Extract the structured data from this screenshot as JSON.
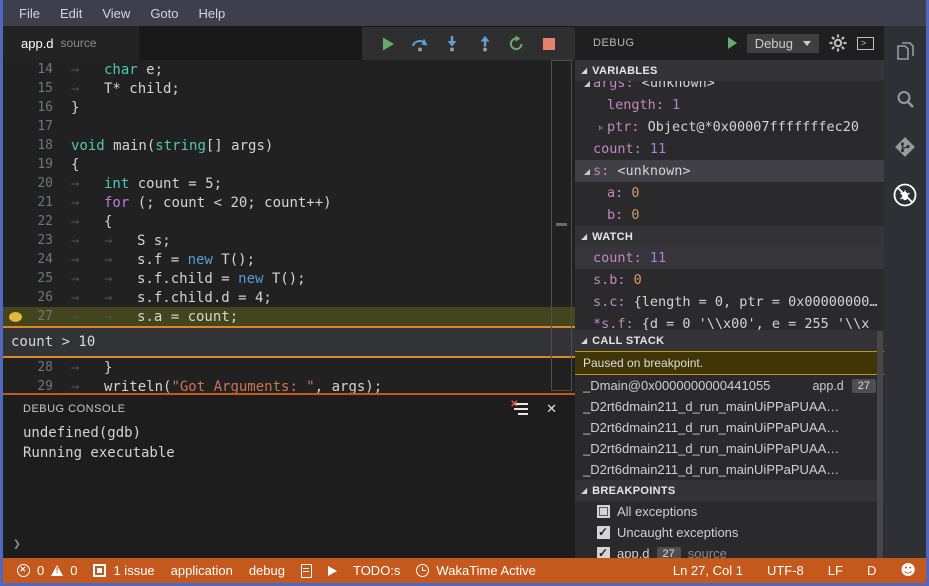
{
  "menu": {
    "items": [
      "File",
      "Edit",
      "View",
      "Goto",
      "Help"
    ]
  },
  "tab": {
    "title": "app.d",
    "subtitle": "source"
  },
  "debug_toolbar": {
    "icons": [
      "continue",
      "step-over",
      "step-into",
      "step-out",
      "restart",
      "stop"
    ]
  },
  "editor": {
    "lines": [
      {
        "num": "14",
        "indent": 1,
        "tokens": [
          [
            "kw",
            "char"
          ],
          [
            "pl",
            " e;"
          ]
        ]
      },
      {
        "num": "15",
        "indent": 1,
        "tokens": [
          [
            "pl",
            "T* child;"
          ]
        ]
      },
      {
        "num": "16",
        "indent": 0,
        "tokens": [
          [
            "pl",
            "}"
          ]
        ]
      },
      {
        "num": "17",
        "indent": 0,
        "tokens": []
      },
      {
        "num": "18",
        "indent": 0,
        "tokens": [
          [
            "kw",
            "void"
          ],
          [
            "pl",
            " main("
          ],
          [
            "kw",
            "string"
          ],
          [
            "pl",
            "[] args)"
          ]
        ]
      },
      {
        "num": "19",
        "indent": 0,
        "tokens": [
          [
            "pl",
            "{"
          ]
        ]
      },
      {
        "num": "20",
        "indent": 1,
        "tokens": [
          [
            "kw",
            "int"
          ],
          [
            "pl",
            " count = 5;"
          ]
        ]
      },
      {
        "num": "21",
        "indent": 1,
        "tokens": [
          [
            "ctrl",
            "for"
          ],
          [
            "pl",
            " (; count < 20; count++)"
          ]
        ]
      },
      {
        "num": "22",
        "indent": 1,
        "tokens": [
          [
            "pl",
            "{"
          ]
        ]
      },
      {
        "num": "23",
        "indent": 2,
        "tokens": [
          [
            "pl",
            "S s;"
          ]
        ]
      },
      {
        "num": "24",
        "indent": 2,
        "tokens": [
          [
            "pl",
            "s.f = "
          ],
          [
            "new",
            "new"
          ],
          [
            "pl",
            " T();"
          ]
        ]
      },
      {
        "num": "25",
        "indent": 2,
        "tokens": [
          [
            "pl",
            "s.f.child = "
          ],
          [
            "new",
            "new"
          ],
          [
            "pl",
            " T();"
          ]
        ]
      },
      {
        "num": "26",
        "indent": 2,
        "tokens": [
          [
            "pl",
            "s.f.child.d = 4;"
          ]
        ]
      },
      {
        "num": "27",
        "indent": 2,
        "tokens": [
          [
            "pl",
            "s.a = count;"
          ]
        ],
        "highlight": true,
        "breakpoint": true,
        "peek_after": true
      },
      {
        "num": "28",
        "indent": 1,
        "tokens": [
          [
            "pl",
            "}"
          ]
        ]
      },
      {
        "num": "29",
        "indent": 1,
        "tokens": [
          [
            "pl",
            "writeln("
          ],
          [
            "str",
            "\"Got Arguments: \""
          ],
          [
            "pl",
            ", args);"
          ]
        ]
      }
    ],
    "peek_text": "count > 10"
  },
  "debug_console": {
    "title": "DEBUG CONSOLE",
    "lines": [
      "undefined(gdb)",
      "Running executable"
    ],
    "prompt": "❯"
  },
  "debug_panel": {
    "title": "DEBUG",
    "dropdown_value": "Debug",
    "variables": {
      "title": "VARIABLES",
      "rows": [
        {
          "name": "args:",
          "value": "<unknown>",
          "indent": 1,
          "tw": "open",
          "vcolor": "plain",
          "clipped": true
        },
        {
          "name": "length:",
          "value": "1",
          "indent": 2,
          "tw": "none",
          "vcolor": "num"
        },
        {
          "name": "ptr:",
          "value": "Object@*0x00007fffffffec20",
          "indent": 2,
          "tw": "closed",
          "vcolor": "plain"
        },
        {
          "name": "count:",
          "value": "11",
          "indent": 1,
          "tw": "none",
          "vcolor": "num"
        },
        {
          "name": "s:",
          "value": "<unknown>",
          "indent": 1,
          "tw": "open",
          "vcolor": "plain",
          "selected": true
        },
        {
          "name": "a:",
          "value": "0",
          "indent": 2,
          "tw": "none",
          "vcolor": "orange"
        },
        {
          "name": "b:",
          "value": "0",
          "indent": 2,
          "tw": "none",
          "vcolor": "orange"
        }
      ]
    },
    "watch": {
      "title": "WATCH",
      "rows": [
        {
          "name": "count:",
          "value": "11",
          "vcolor": "num",
          "selected": true
        },
        {
          "name": "s.b:",
          "value": "0",
          "vcolor": "orange"
        },
        {
          "name": "s.c:",
          "value": "{length = 0, ptr = 0x00000000…",
          "vcolor": "plain"
        },
        {
          "name": "*s.f:",
          "value": "{d = 0 '\\\\x00', e = 255 '\\\\x",
          "vcolor": "plain"
        }
      ]
    },
    "call_stack": {
      "title": "CALL STACK",
      "status": "Paused on breakpoint.",
      "frames": [
        {
          "name": "_Dmain@0x0000000000441055",
          "file": "app.d",
          "line": "27"
        },
        {
          "name": "_D2rt6dmain211_d_run_mainUiPPaPUAA…"
        },
        {
          "name": "_D2rt6dmain211_d_run_mainUiPPaPUAA…"
        },
        {
          "name": "_D2rt6dmain211_d_run_mainUiPPaPUAA…"
        },
        {
          "name": "_D2rt6dmain211_d_run_mainUiPPaPUAA…"
        }
      ]
    },
    "breakpoints": {
      "title": "BREAKPOINTS",
      "items": [
        {
          "label": "All exceptions",
          "checked": false
        },
        {
          "label": "Uncaught exceptions",
          "checked": true
        },
        {
          "label": "app.d",
          "checked": true,
          "badge": "27",
          "suffix": "source"
        }
      ]
    }
  },
  "activity_bar": {
    "icons": [
      "files",
      "search",
      "source-control",
      "debug-stop"
    ]
  },
  "status_bar": {
    "errors": "0",
    "warnings": "0",
    "items_left": [
      {
        "icon": "issue-box",
        "label": "1 issue"
      },
      {
        "label": "application"
      },
      {
        "label": "debug"
      },
      {
        "icon": "file"
      },
      {
        "icon": "play"
      },
      {
        "label": "TODO:s"
      },
      {
        "icon": "clock",
        "label": "WakaTime Active"
      }
    ],
    "items_right": [
      {
        "label": "Ln 27, Col 1"
      },
      {
        "label": "UTF-8"
      },
      {
        "label": "LF"
      },
      {
        "label": "D"
      },
      {
        "icon": "smiley"
      }
    ]
  },
  "colors": {
    "accent_border": "#4f68be",
    "status_bar": "#c5581c",
    "breakpoint": "#e2b73d",
    "peek_border": "#dd8527"
  }
}
